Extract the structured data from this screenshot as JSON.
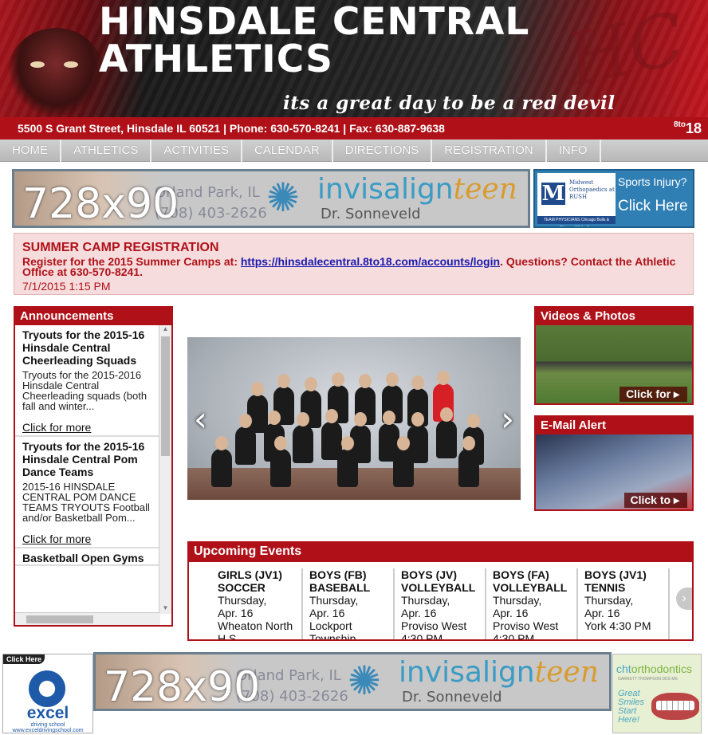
{
  "header": {
    "site_title_line1": "HINSDALE CENTRAL",
    "site_title_line2": "ATHLETICS",
    "tagline": "its a great day to be a red devil",
    "script_mark": "HC"
  },
  "address_bar": {
    "text": "5500 S Grant Street, Hinsdale IL 60521 | Phone: 630-570-8241 | Fax: 630-887-9638",
    "logo_top": "8to",
    "logo_bottom": "18"
  },
  "nav": {
    "items": [
      "HOME",
      "ATHLETICS",
      "ACTIVITIES",
      "CALENDAR",
      "DIRECTIONS",
      "REGISTRATION",
      "INFO"
    ]
  },
  "ads": {
    "top": {
      "size": "728x90",
      "city": "Orland Park, IL",
      "phone": "(708) 403-2626",
      "brand": "invisalign",
      "brand_suffix": "teen",
      "doctor": "Dr. Sonneveld"
    },
    "ortho": {
      "logo_mark": "M",
      "logo_text": "Midwest Orthopaedics at RUSH",
      "logo_bar": "TEAM PHYSICIANS Chicago Bulls & Chicago White Sox",
      "question": "Sports Injury?",
      "cta": "Click Here"
    },
    "bottom": {
      "size": "728x90",
      "city": "Orland Park, IL",
      "phone": "(708) 403-2626",
      "brand": "invisalign",
      "brand_suffix": "teen",
      "doctor": "Dr. Sonneveld"
    },
    "excel": {
      "click_here": "Click Here",
      "name": "excel",
      "sub": "www.exceldrivingschool.com",
      "tagline": "driving school"
    },
    "cht": {
      "name_a": "cht",
      "name_b": "orthodontics",
      "sub": "GARRETT THOMPSON DDS MS",
      "text": "Great Smiles Start Here!"
    }
  },
  "alert": {
    "title": "SUMMER CAMP REGISTRATION",
    "body_prefix": "Register for the 2015 Summer Camps at: ",
    "link": "https://hinsdalecentral.8to18.com/accounts/login",
    "body_suffix": ".  Questions? Contact the Athletic Office at 630-570-8241.",
    "date": "7/1/2015 1:15 PM"
  },
  "announcements": {
    "heading": "Announcements",
    "items": [
      {
        "title": "Tryouts for the 2015-16 Hinsdale Central Cheerleading Squads",
        "snippet": "Tryouts for the 2015-2016 Hinsdale Central Cheerleading squads (both fall and winter...",
        "more": "Click for more"
      },
      {
        "title": "Tryouts for the 2015-16 Hinsdale Central Pom Dance Teams",
        "snippet": "2015-16 HINSDALE CENTRAL POM DANCE TEAMS TRYOUTS Football and/or Basketball Pom...",
        "more": "Click for more"
      },
      {
        "title": "Basketball Open Gyms",
        "snippet": "",
        "more": ""
      }
    ]
  },
  "videos": {
    "heading": "Videos & Photos",
    "cta": "Click for"
  },
  "email_alert": {
    "heading": "E-Mail Alert",
    "cta": "Click to"
  },
  "events": {
    "heading": "Upcoming Events",
    "items": [
      {
        "title": "GIRLS (JV1) SOCCER",
        "day": "Thursday,",
        "date": "Apr. 16",
        "where": "Wheaton North H.S."
      },
      {
        "title": "BOYS (FB) BASEBALL",
        "day": "Thursday,",
        "date": "Apr. 16",
        "where": "Lockport Township"
      },
      {
        "title": "BOYS (JV) VOLLEYBALL",
        "day": "Thursday,",
        "date": "Apr. 16",
        "where": "Proviso West 4:30 PM"
      },
      {
        "title": "BOYS (FA) VOLLEYBALL",
        "day": "Thursday,",
        "date": "Apr. 16",
        "where": "Proviso West 4:30 PM"
      },
      {
        "title": "BOYS (JV1) TENNIS",
        "day": "Thursday,",
        "date": "Apr. 16",
        "where": "York 4:30 PM"
      }
    ]
  },
  "colors": {
    "brand_red": "#b01119",
    "nav_gray": "#c4c4c4",
    "link_blue": "#1a1ab0"
  }
}
